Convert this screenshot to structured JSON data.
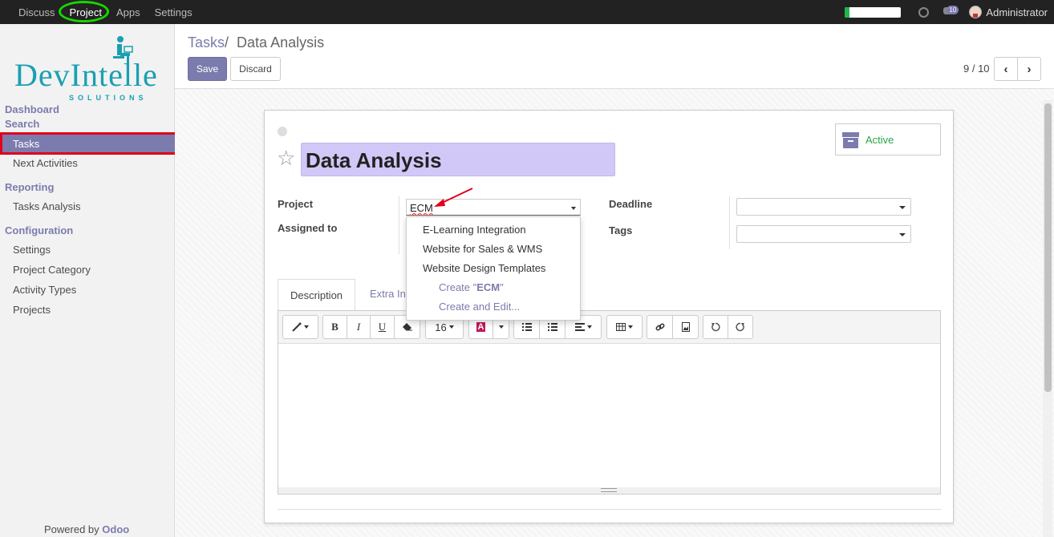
{
  "topbar": {
    "menu": [
      "Discuss",
      "Project",
      "Apps",
      "Settings"
    ],
    "active_menu": "Project",
    "progress_fraction": 0.08,
    "message_count": "10",
    "user": "Administrator"
  },
  "sidebar": {
    "logo_text": "DevIntelle",
    "logo_sub": "SOLUTIONS",
    "sections": [
      {
        "label": "Dashboard"
      },
      {
        "label": "Search"
      },
      {
        "label": "Reporting"
      },
      {
        "label": "Configuration"
      }
    ],
    "items": {
      "tasks": "Tasks",
      "next_activities": "Next Activities",
      "tasks_analysis": "Tasks Analysis",
      "settings": "Settings",
      "project_category": "Project Category",
      "activity_types": "Activity Types",
      "projects": "Projects"
    },
    "powered_prefix": "Powered by",
    "powered_brand": "Odoo"
  },
  "breadcrumb": {
    "parent": "Tasks",
    "separator": "/",
    "current": "Data Analysis"
  },
  "buttons": {
    "save": "Save",
    "discard": "Discard"
  },
  "pager": {
    "text": "9 / 10",
    "prev": "‹",
    "next": "›"
  },
  "form": {
    "title": "Data Analysis",
    "status": "Active",
    "labels": {
      "project": "Project",
      "assigned_to": "Assigned to",
      "deadline": "Deadline",
      "tags": "Tags"
    },
    "project_value": "ECM",
    "dropdown": {
      "options": [
        "E-Learning Integration",
        "Website for Sales & WMS",
        "Website Design Templates"
      ],
      "create_prefix": "Create \"",
      "create_term": "ECM",
      "create_suffix": "\"",
      "create_edit": "Create and Edit..."
    },
    "tabs": {
      "description": "Description",
      "extra": "Extra In"
    },
    "font_size": "16"
  },
  "colors": {
    "brand": "#7c7bad",
    "highlight_red": "#e0001a",
    "highlight_green": "#19d500",
    "title_bg": "#d2c8f8",
    "active_green": "#28a745"
  }
}
